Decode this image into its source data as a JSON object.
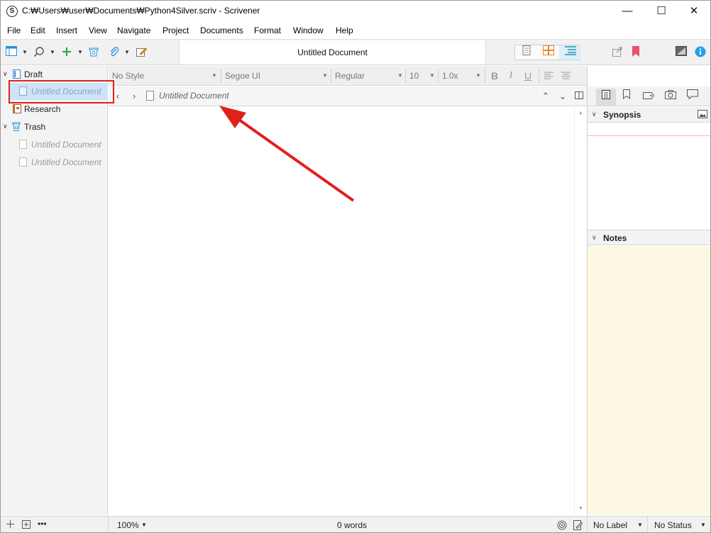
{
  "window": {
    "title": "C:₩Users₩user₩Documents₩Python4Silver.scriv - Scrivener",
    "app_icon_letter": "S",
    "minimize_glyph": "—",
    "maximize_glyph": "☐",
    "close_glyph": "✕"
  },
  "menu": [
    "File",
    "Edit",
    "Insert",
    "View",
    "Navigate",
    "Project",
    "Documents",
    "Format",
    "Window",
    "Help"
  ],
  "toolbar": {
    "document_title": "Untitled Document",
    "accent_green": "#2eaa4a",
    "accent_orange": "#e8862a",
    "accent_blue": "#2a8fd6"
  },
  "binder": {
    "items": [
      {
        "label": "Draft",
        "icon": "draft-doc-icon",
        "expanded": true
      },
      {
        "label": "Untitled Document",
        "icon": "document-icon",
        "selected": true
      },
      {
        "label": "Research",
        "icon": "research-folder-icon"
      },
      {
        "label": "Trash",
        "icon": "trash-icon",
        "expanded": true
      },
      {
        "label": "Untitled Document",
        "icon": "document-icon"
      },
      {
        "label": "Untitled Document",
        "icon": "document-icon"
      }
    ]
  },
  "format_bar": {
    "style": "No Style",
    "font": "Segoe UI",
    "weight": "Regular",
    "size": "10",
    "line_spacing": "1.0x",
    "bold": "B",
    "italic": "I",
    "underline": "U"
  },
  "editor": {
    "header_title": "Untitled Document"
  },
  "inspector": {
    "synopsis_label": "Synopsis",
    "notes_label": "Notes",
    "notes_bg": "#fdf8e2"
  },
  "status": {
    "binder_more": "•••",
    "zoom": "100%",
    "word_count": "0 words",
    "label": "No Label",
    "status": "No Status"
  },
  "annotation": {
    "color": "#e0201a"
  }
}
